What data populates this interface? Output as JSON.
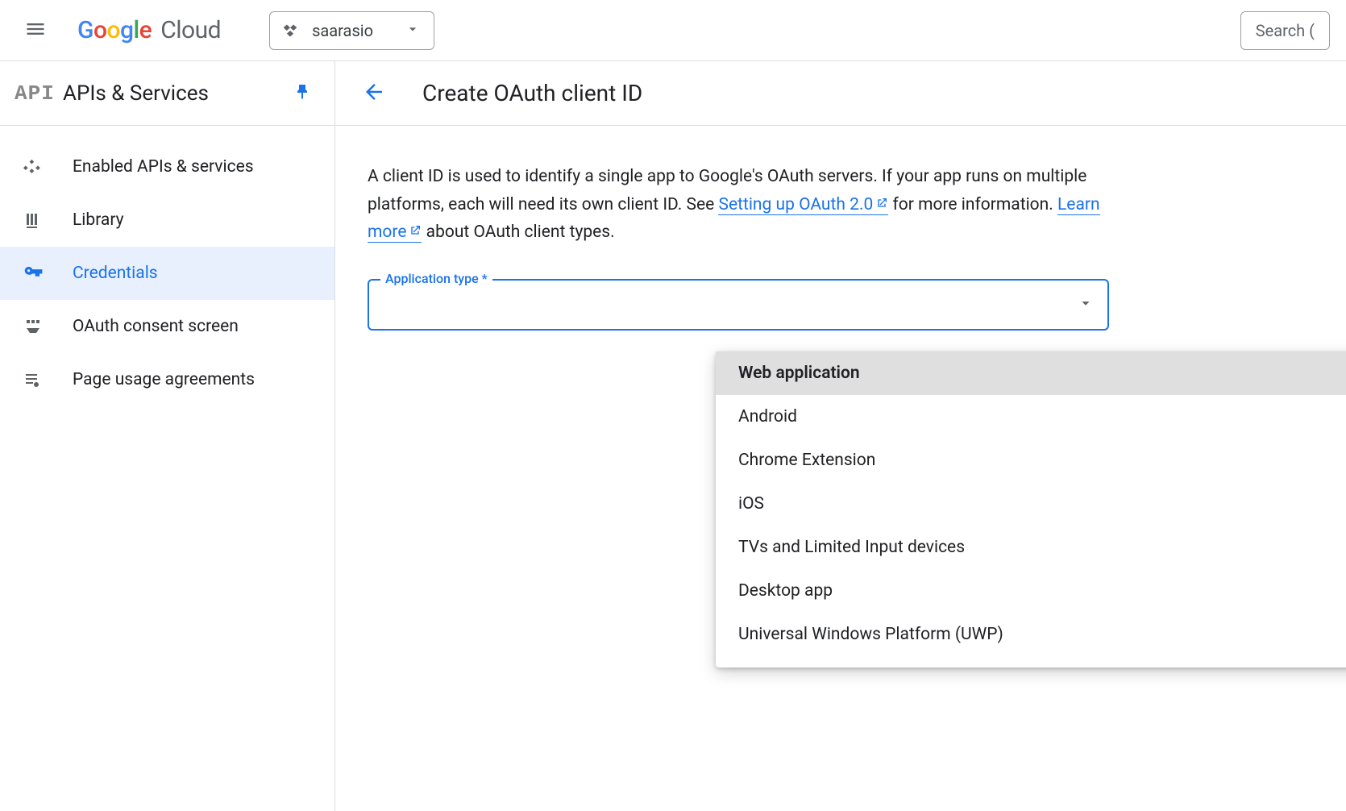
{
  "header": {
    "project_name": "saarasio",
    "search_placeholder": "Search ("
  },
  "sidebar": {
    "title": "APIs & Services",
    "items": [
      {
        "label": "Enabled APIs & services"
      },
      {
        "label": "Library"
      },
      {
        "label": "Credentials"
      },
      {
        "label": "OAuth consent screen"
      },
      {
        "label": "Page usage agreements"
      }
    ],
    "active_index": 2
  },
  "page": {
    "title": "Create OAuth client ID",
    "description_pre": "A client ID is used to identify a single app to Google's OAuth servers. If your app runs on multiple platforms, each will need its own client ID. See ",
    "link1": "Setting up OAuth 2.0",
    "description_mid": " for more information. ",
    "link2": "Learn more",
    "description_post": " about OAuth client types."
  },
  "select": {
    "label": "Application type *"
  },
  "dropdown": {
    "options": [
      "Web application",
      "Android",
      "Chrome Extension",
      "iOS",
      "TVs and Limited Input devices",
      "Desktop app",
      "Universal Windows Platform (UWP)"
    ],
    "highlighted_index": 0
  }
}
